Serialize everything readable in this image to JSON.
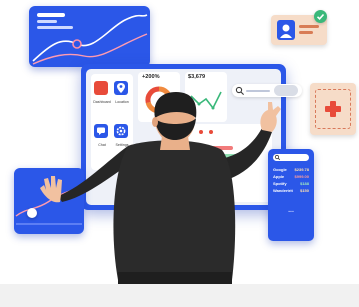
{
  "dashboard": {
    "stat_percent": "+200%",
    "stat_amount": "$3,679",
    "app_tiles": [
      {
        "label": "Dashboard",
        "icon": "person-icon"
      },
      {
        "label": "Location",
        "icon": "location-pin-icon"
      },
      {
        "label": "Chat",
        "icon": "chat-icon"
      },
      {
        "label": "Settings",
        "icon": "gear-icon"
      }
    ]
  },
  "price_list": {
    "items": [
      {
        "name": "Google",
        "value": "$239.78"
      },
      {
        "name": "Apple",
        "value": "$999.00"
      },
      {
        "name": "Spotify",
        "value": "$188"
      },
      {
        "name": "Wandertrit",
        "value": "$150"
      }
    ],
    "more": "..."
  },
  "colors": {
    "primary_blue": "#2b57e8",
    "accent_red": "#e84b3a",
    "accent_orange": "#f08a3e",
    "accent_green": "#3ab87a",
    "card_peach": "#f6dcc8"
  }
}
